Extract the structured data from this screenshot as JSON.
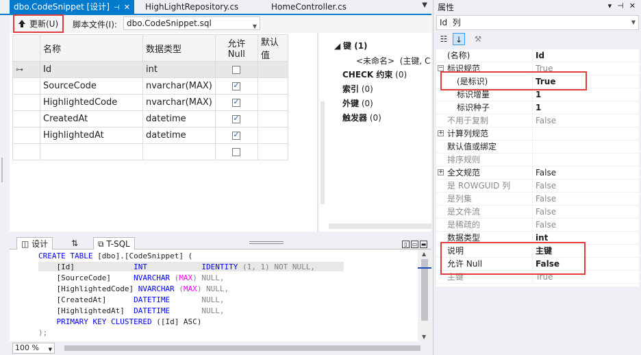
{
  "tabs": [
    {
      "label": "dbo.CodeSnippet [设计]",
      "active": true
    },
    {
      "label": "HighLightRepository.cs",
      "active": false
    },
    {
      "label": "HomeController.cs",
      "active": false
    }
  ],
  "toolbar": {
    "update_label": "更新(U)",
    "script_label": "脚本文件(I):",
    "script_value": "dbo.CodeSnippet.sql"
  },
  "grid": {
    "headers": [
      "名称",
      "数据类型",
      "允许 Null",
      "默认值"
    ],
    "rows": [
      {
        "name": "Id",
        "type": "int",
        "null": false,
        "pk": true
      },
      {
        "name": "SourceCode",
        "type": "nvarchar(MAX)",
        "null": true,
        "pk": false
      },
      {
        "name": "HighlightedCode",
        "type": "nvarchar(MAX)",
        "null": true,
        "pk": false
      },
      {
        "name": "CreatedAt",
        "type": "datetime",
        "null": true,
        "pk": false
      },
      {
        "name": "HighlightedAt",
        "type": "datetime",
        "null": true,
        "pk": false
      }
    ]
  },
  "keys": {
    "key_header": "键 (1)",
    "key_item": "<未命名>  (主键, C",
    "check": "CHECK 约束",
    "check_count": "(0)",
    "index": "索引",
    "index_count": "(0)",
    "fk": "外键",
    "fk_count": "(0)",
    "trigger": "触发器",
    "trigger_count": "(0)"
  },
  "pane_tabs": {
    "design": "设计",
    "swap": "⇅",
    "tsql": "T-SQL"
  },
  "sql": {
    "l1a": "CREATE TABLE",
    "l1b": " [dbo].[CodeSnippet] (",
    "l2a": "    [Id]             ",
    "l2b": "INT",
    "l2c": "            IDENTITY",
    "l2d": " (1, 1) NOT NULL,",
    "l3a": "    [SourceCode]     ",
    "l3b": "NVARCHAR",
    "l3c": " (",
    "l3d": "MAX",
    "l3e": ") NULL,",
    "l4a": "    [HighlightedCode]",
    "l4b": " NVARCHAR",
    "l4c": " (",
    "l4d": "MAX",
    "l4e": ") NULL,",
    "l5a": "    [CreatedAt]      ",
    "l5b": "DATETIME",
    "l5c": "       NULL,",
    "l6a": "    [HighlightedAt]  ",
    "l6b": "DATETIME",
    "l6c": "       NULL,",
    "l7a": "    PRIMARY KEY CLUSTERED",
    "l7b": " ([Id] ASC)",
    "l8": ");"
  },
  "zoom": "100 %",
  "props": {
    "title": "属性",
    "object": "Id  列",
    "rows": [
      {
        "name": "(名称)",
        "value": "Id",
        "nclass": "",
        "vclass": "bold"
      },
      {
        "name": "标识规范",
        "value": "True",
        "nclass": "",
        "vclass": "gray",
        "exp": "⊟"
      },
      {
        "name": "(是标识)",
        "value": "True",
        "nclass": "ind",
        "vclass": "bold"
      },
      {
        "name": "标识增量",
        "value": "1",
        "nclass": "ind",
        "vclass": "bold"
      },
      {
        "name": "标识种子",
        "value": "1",
        "nclass": "ind",
        "vclass": "bold"
      },
      {
        "name": "不用于复制",
        "value": "False",
        "nclass": "gray",
        "vclass": "gray"
      },
      {
        "name": "计算列规范",
        "value": "",
        "nclass": "",
        "vclass": "",
        "exp": "⊞"
      },
      {
        "name": "默认值或绑定",
        "value": "",
        "nclass": "",
        "vclass": ""
      },
      {
        "name": "排序规则",
        "value": "",
        "nclass": "gray",
        "vclass": ""
      },
      {
        "name": "全文规范",
        "value": "False",
        "nclass": "",
        "vclass": "",
        "exp": "⊞"
      },
      {
        "name": "是 ROWGUID 列",
        "value": "False",
        "nclass": "gray",
        "vclass": "gray"
      },
      {
        "name": "是列集",
        "value": "False",
        "nclass": "gray",
        "vclass": "gray"
      },
      {
        "name": "是文件流",
        "value": "False",
        "nclass": "gray",
        "vclass": "gray"
      },
      {
        "name": "是稀疏的",
        "value": "False",
        "nclass": "gray",
        "vclass": "gray"
      },
      {
        "name": "数据类型",
        "value": "int",
        "nclass": "",
        "vclass": "bold"
      },
      {
        "name": "说明",
        "value": "主键",
        "nclass": "",
        "vclass": "bold"
      },
      {
        "name": "允许 Null",
        "value": "False",
        "nclass": "",
        "vclass": "bold"
      },
      {
        "name": "主键",
        "value": "True",
        "nclass": "gray",
        "vclass": "gray"
      }
    ]
  }
}
